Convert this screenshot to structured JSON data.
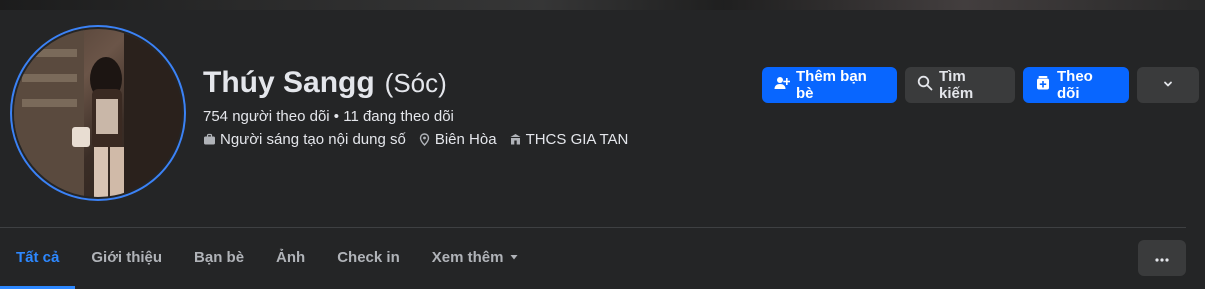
{
  "profile": {
    "name": "Thúy Sangg",
    "nickname": "(Sóc)",
    "stats": "754 người theo dõi • 11 đang theo dõi",
    "details": [
      {
        "icon": "briefcase-icon",
        "text": "Người sáng tạo nội dung số"
      },
      {
        "icon": "location-pin-icon",
        "text": "Biên Hòa"
      },
      {
        "icon": "school-icon",
        "text": "THCS GIA TAN"
      }
    ]
  },
  "actions": {
    "add_friend": "Thêm bạn bè",
    "search": "Tìm kiếm",
    "follow": "Theo dõi"
  },
  "tabs": [
    {
      "label": "Tất cả",
      "active": true
    },
    {
      "label": "Giới thiệu"
    },
    {
      "label": "Bạn bè"
    },
    {
      "label": "Ảnh"
    },
    {
      "label": "Check in"
    },
    {
      "label": "Xem thêm"
    }
  ],
  "colors": {
    "background": "#242526",
    "primary": "#0866ff",
    "secondary": "#3a3b3c",
    "active_tab": "#2d88ff",
    "avatar_ring": "#3b82f6"
  }
}
